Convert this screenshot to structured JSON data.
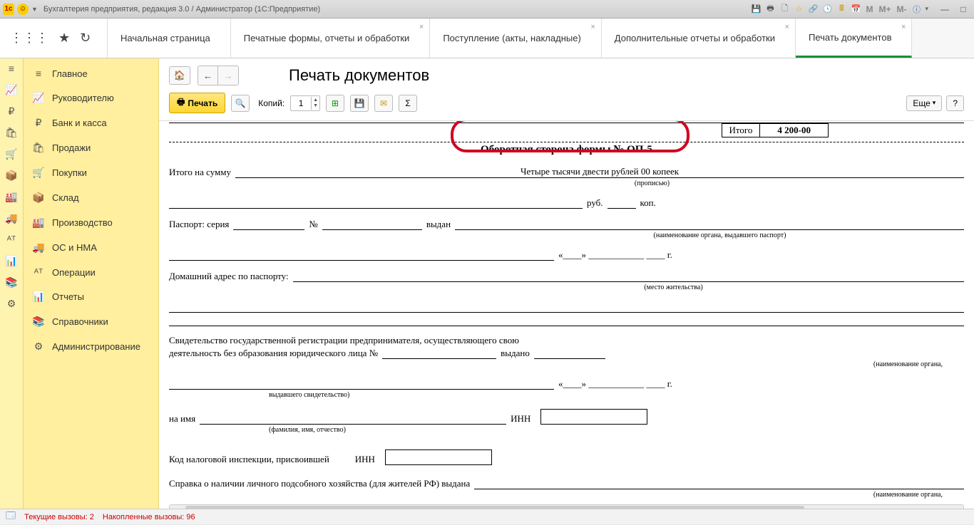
{
  "titlebar": {
    "title": "Бухгалтерия предприятия, редакция 3.0 / Администратор  (1С:Предприятие)",
    "m_buttons": [
      "M",
      "M+",
      "M-"
    ]
  },
  "tabs": [
    {
      "label": "Начальная страница",
      "closable": false
    },
    {
      "label": "Печатные формы, отчеты и обработки",
      "closable": true
    },
    {
      "label": "Поступление (акты, накладные)",
      "closable": true
    },
    {
      "label": "Дополнительные отчеты и обработки",
      "closable": true
    },
    {
      "label": "Печать документов",
      "closable": true,
      "active": true
    }
  ],
  "sidebar": {
    "items": [
      {
        "icon": "≡",
        "label": "Главное"
      },
      {
        "icon": "📈",
        "label": "Руководителю"
      },
      {
        "icon": "₽",
        "label": "Банк и касса"
      },
      {
        "icon": "🛍",
        "label": "Продажи"
      },
      {
        "icon": "🛒",
        "label": "Покупки"
      },
      {
        "icon": "📦",
        "label": "Склад"
      },
      {
        "icon": "🏭",
        "label": "Производство"
      },
      {
        "icon": "🚚",
        "label": "ОС и НМА"
      },
      {
        "icon": "ᴬᵀ",
        "label": "Операции"
      },
      {
        "icon": "📊",
        "label": "Отчеты"
      },
      {
        "icon": "📚",
        "label": "Справочники"
      },
      {
        "icon": "⚙",
        "label": "Администрирование"
      }
    ]
  },
  "main": {
    "title": "Печать документов",
    "toolbar": {
      "print_label": "Печать",
      "copies_label": "Копий:",
      "copies_value": "1",
      "more_label": "Еще",
      "help_label": "?"
    }
  },
  "document": {
    "itogo_label": "Итого",
    "itogo_value": "4 200-00",
    "form_title": "Оборотная сторона формы № ОП-5",
    "total_label": "Итого на сумму",
    "total_words": "Четыре тысячи двести рублей 00 копеек",
    "total_sub": "(прописью)",
    "rub": "руб.",
    "kop": "коп.",
    "passport_label": "Паспорт: серия",
    "passport_no": "№",
    "passport_issued": "выдан",
    "passport_sub": "(наименование органа, выдавшего паспорт)",
    "date_pattern": "«____»  ____________ ____ г.",
    "address_label": "Домашний адрес по паспорту:",
    "address_sub": "(место жительства)",
    "cert_text1": "Свидетельство государственной регистрации предпринимателя, осуществляющего свою",
    "cert_text2": "деятельность без образования юридического лица №",
    "cert_issued": "выдано",
    "cert_sub1": "(наименование органа,",
    "cert_sub2": "выдавшего свидетельство)",
    "name_label": "на имя",
    "name_sub": "(фамилия, имя, отчество)",
    "inn_label": "ИНН",
    "tax_label": "Код налоговой инспекции, присвоившей",
    "tax_inn": "ИНН",
    "household_label": "Справка о наличии личного подсобного хозяйства (для жителей РФ) выдана",
    "household_sub": "(наименование органа,"
  },
  "statusbar": {
    "current_calls": "Текущие вызовы: 2",
    "accumulated_calls": "Накопленные вызовы: 96"
  }
}
